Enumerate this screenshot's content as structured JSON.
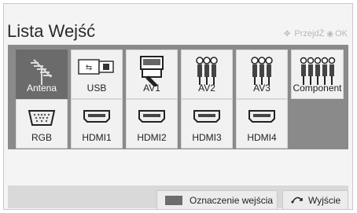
{
  "header": {
    "title": "Lista Wejść",
    "hint_move": "PrzejdŹ",
    "hint_ok": "OK"
  },
  "inputs": [
    {
      "label": "Antena",
      "icon": "antenna-icon",
      "selected": true
    },
    {
      "label": "USB",
      "icon": "usb-icon"
    },
    {
      "label": "AV1",
      "icon": "scart-icon"
    },
    {
      "label": "AV2",
      "icon": "rca-3-icon"
    },
    {
      "label": "AV3",
      "icon": "rca-3-icon"
    },
    {
      "label": "Component",
      "icon": "rca-5-icon"
    },
    {
      "label": "RGB",
      "icon": "vga-icon"
    },
    {
      "label": "HDMI1",
      "icon": "hdmi-icon"
    },
    {
      "label": "HDMI2",
      "icon": "hdmi-icon"
    },
    {
      "label": "HDMI3",
      "icon": "hdmi-icon"
    },
    {
      "label": "HDMI4",
      "icon": "hdmi-icon"
    }
  ],
  "footer": {
    "mark_label": "Oznaczenie wejścia",
    "exit_label": "Wyjście"
  },
  "colors": {
    "grid_background": "#8a8a8a",
    "selected_tile": "#6b6b6b",
    "hint_text": "#b9b9b9"
  }
}
